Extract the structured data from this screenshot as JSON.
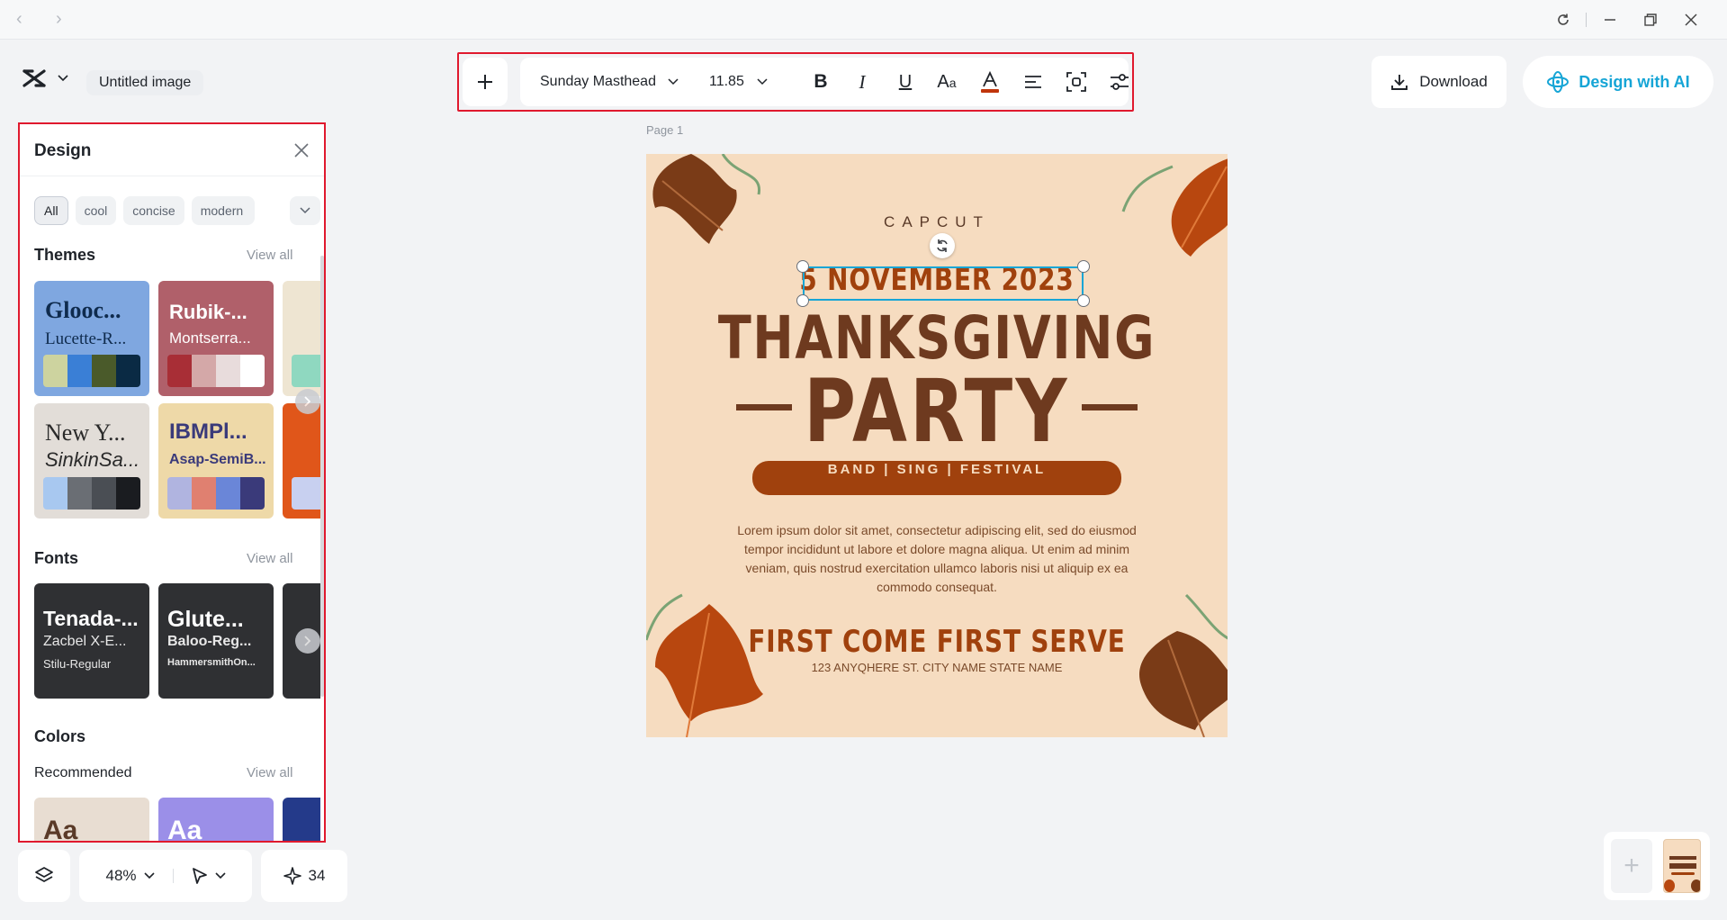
{
  "document": {
    "title": "Untitled image"
  },
  "toolbar": {
    "font_name": "Sunday Masthead",
    "font_size": "11.85"
  },
  "header": {
    "download_label": "Download",
    "ai_label": "Design with AI"
  },
  "panel": {
    "title": "Design",
    "chips": [
      "All",
      "cool",
      "concise",
      "modern"
    ],
    "themes_title": "Themes",
    "fonts_title": "Fonts",
    "colors_title": "Colors",
    "recommended_label": "Recommended",
    "view_all": "View all",
    "themes": [
      {
        "heading": "Glooc...",
        "sub": "Lucette-R...",
        "bg": "#7fa7e0",
        "fg": "#0f2b4d",
        "swatches": [
          "#cdd39f",
          "#3a7fd6",
          "#4a5a2a",
          "#0a2a44"
        ]
      },
      {
        "heading": "Rubik-...",
        "sub": "Montserra...",
        "bg": "#b0606a",
        "fg": "#ffffff",
        "swatches": [
          "#a82e36",
          "#d4a8a8",
          "#e8dcdc",
          "#ffffff"
        ]
      },
      {
        "heading": "New Y...",
        "sub": "SinkinSa...",
        "bg": "#e2ddd8",
        "fg": "#2a2a2a",
        "swatches": [
          "#a8c8f0",
          "#6a6e74",
          "#4a4e54",
          "#1a1c20"
        ]
      },
      {
        "heading": "IBMPl...",
        "sub": "Asap-SemiB...",
        "bg": "#eed9a8",
        "fg": "#3a3a7a",
        "swatches": [
          "#b0b4e0",
          "#e08070",
          "#6a86d8",
          "#3a3a7a"
        ]
      }
    ],
    "fonts": [
      {
        "line1": "Tenada-...",
        "line2": "Zacbel X-E...",
        "line3": "Stilu-Regular"
      },
      {
        "line1": "Glute...",
        "line2": "Baloo-Reg...",
        "line3": "HammersmithOn..."
      }
    ],
    "color_cards": [
      {
        "text": "Aa",
        "bg": "#e8ddd2",
        "fg": "#5a3a28"
      },
      {
        "text": "Aa",
        "bg": "#9b8fe8",
        "fg": "#ffffff"
      }
    ]
  },
  "bottombar": {
    "zoom": "48%",
    "credits": "34"
  },
  "canvas": {
    "page_label": "Page 1",
    "brand": "CAPCUT",
    "date": "5 NOVEMBER 2023",
    "title1": "THANKSGIVING",
    "title2": "PARTY",
    "banner": "BAND | SING | FESTIVAL",
    "body": "Lorem ipsum dolor sit amet, consectetur adipiscing elit, sed do eiusmod tempor incididunt ut labore et dolore magna aliqua. Ut enim ad minim veniam, quis nostrud exercitation ullamco laboris nisi ut aliquip ex ea commodo consequat.",
    "serve": "FIRST COME FIRST SERVE",
    "address": "123 ANYQHERE ST. CITY NAME  STATE NAME"
  },
  "colors": {
    "accent": "#16a5d6",
    "highlight_outline": "#e0192e",
    "poster_bg": "#f6dcc0",
    "poster_brown": "#6e3a1f",
    "poster_orange": "#a0410d"
  }
}
